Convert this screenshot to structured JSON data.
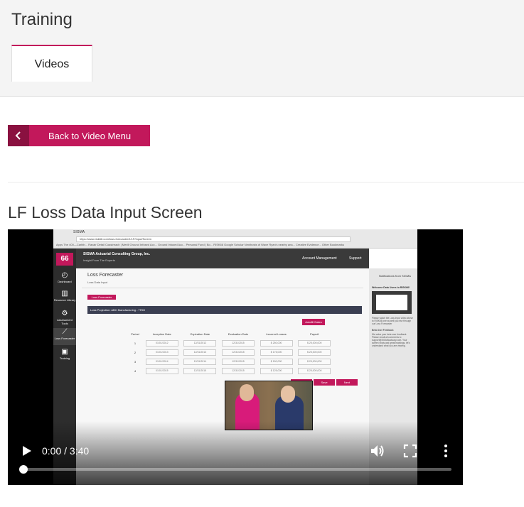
{
  "header": {
    "title": "Training",
    "tabs": [
      {
        "label": "Videos",
        "active": true
      }
    ]
  },
  "back_button": {
    "label": "Back to Video Menu",
    "icon": "chevron-left-icon"
  },
  "section": {
    "title": "LF Loss Data Input Screen"
  },
  "video": {
    "time": "0:00 / 3:40",
    "progress": 0,
    "controls": [
      "play-icon",
      "volume-icon",
      "fullscreen-icon",
      "more-icon"
    ],
    "frame": {
      "browser_tab": "SIGMA",
      "url": "https://www.risk66.com/loss-forecaster/1/LF/Input/Screen",
      "bookmarks": "Apps  The 400—Caribb...  Ravair Detail  Coastreach | Merill  Ground Infused Acc...  Ground Infused Acc...  Personal Fund | Bo...  RISK66  Google Scholar  Nexthosts of Wave  Ryan's nearby ana...  Creative Evidence...  Other Bookmarks",
      "org": "SIGMA Actuarial Consulting Group, Inc.",
      "org_sub": "Insight From The Experts",
      "logo": "66",
      "account": "Account Management",
      "support": "Support",
      "sidebar": [
        "Dashboard",
        "Resource Library",
        "Assessment Tools",
        "Loss Forecaster",
        "Training"
      ],
      "page_title": "Loss Forecaster",
      "page_sub": "Loss Data Input",
      "lf_button": "Loss Forecaster",
      "projection": "Loss Projection: ABC Manufacturing - TRIG",
      "update_button": "Autofill Dates",
      "columns": [
        "Period",
        "Inception Date",
        "Expiration Date",
        "Evaluation Date",
        "Incurred Losses",
        "Payroll"
      ],
      "rows": [
        [
          "1",
          "01/01/2012",
          "12/31/2012",
          "12/31/2015",
          "$ 250,000",
          "$ 25,000,000"
        ],
        [
          "2",
          "01/01/2013",
          "12/31/2013",
          "12/31/2015",
          "$ 175,000",
          "$ 25,000,000"
        ],
        [
          "3",
          "01/01/2014",
          "12/31/2014",
          "12/31/2015",
          "$ 150,000",
          "$ 25,000,000"
        ],
        [
          "4",
          "01/01/2015",
          "12/31/2015",
          "12/31/2015",
          "$ 125,000",
          "$ 25,000,000"
        ]
      ],
      "nav_buttons": [
        "Back",
        "Save",
        "Next"
      ],
      "notifications_title": "Notifications from SIGMA",
      "welcome": "Welcome Data Users to RISK66!",
      "notif_text": "Please watch the Loss Input video above to RISK66 one as well you rise through our Loss Forecaster",
      "feedback_title": "Beta User Feedback",
      "feedback_text": "We value your beta user feedback. Please email all comments to support@SIGMAactuary.com. Your screen shots and great markings, let's understand what you are viewing."
    }
  }
}
